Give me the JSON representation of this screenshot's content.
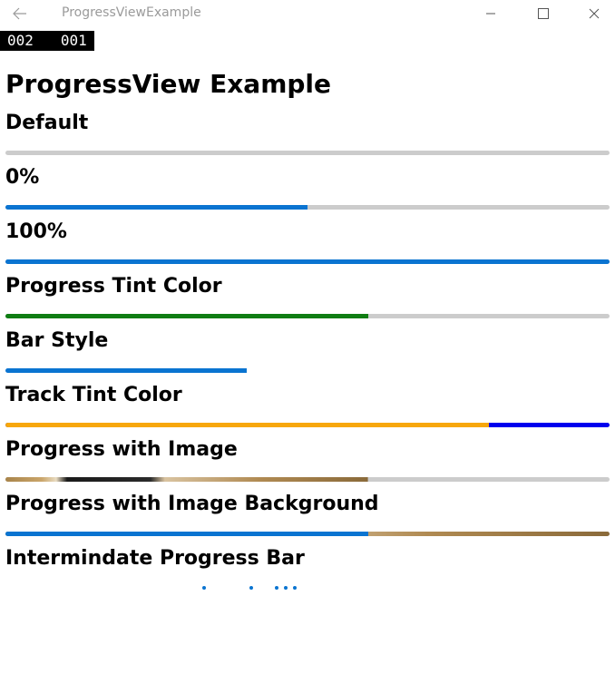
{
  "window": {
    "title": "ProgressViewExample",
    "controls": {
      "back": "back-arrow-icon",
      "minimize": "minimize-icon",
      "maximize": "maximize-icon",
      "close": "close-icon"
    }
  },
  "counter": {
    "values": [
      "002",
      "001"
    ]
  },
  "page": {
    "title": "ProgressView Example"
  },
  "colors": {
    "accent": "#0a74d1",
    "track": "#cccccc",
    "tint_green": "#0f7d13",
    "tint_orange": "#f7a70c",
    "track_blue": "#0000ee"
  },
  "sections": [
    {
      "label": "Default",
      "progress": 0,
      "fill_color": "#0a74d1",
      "track_color": "#cccccc"
    },
    {
      "label": "0%",
      "progress": 0.5,
      "fill_color": "#0a74d1",
      "track_color": "#cccccc"
    },
    {
      "label": "100%",
      "progress": 1.0,
      "fill_color": "#0a74d1",
      "track_color": "#cccccc"
    },
    {
      "label": "Progress Tint Color",
      "progress": 0.6,
      "fill_color": "#0f7d13",
      "track_color": "#cccccc"
    },
    {
      "label": "Bar Style",
      "progress": 0.4,
      "fill_color": "#0a74d1",
      "track_color": "transparent"
    },
    {
      "label": "Track Tint Color",
      "progress": 0.8,
      "fill_color": "#f7a70c",
      "track_color": "#0000ee"
    },
    {
      "label": "Progress with Image",
      "progress": 0.6,
      "fill_color": "image",
      "track_color": "#cccccc"
    },
    {
      "label": "Progress with Image Background",
      "progress": 0.6,
      "fill_color": "#0a74d1",
      "track_color": "image"
    },
    {
      "label": "Intermindate Progress Bar",
      "progress": null,
      "indeterminate": true,
      "fill_color": "#0a74d1"
    }
  ]
}
